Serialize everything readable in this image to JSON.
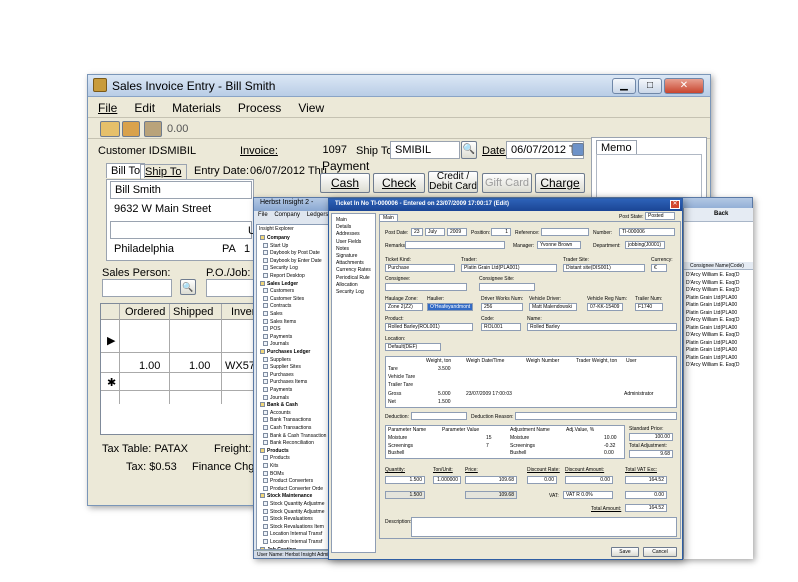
{
  "sales": {
    "title": "Sales Invoice Entry - Bill Smith",
    "menu": [
      {
        "label": "File"
      },
      {
        "label": "Edit"
      },
      {
        "label": "Materials"
      },
      {
        "label": "Process"
      },
      {
        "label": "View"
      }
    ],
    "toolbar_amount": "0.00",
    "customer_id_label": "Customer ID:",
    "customer_id": "SMIBIL",
    "invoice_label": "Invoice:",
    "invoice": "1097",
    "ship_to_label": "Ship To:",
    "ship_to": "SMIBIL",
    "date_label": "Date:",
    "date": "06/07/2012 Thu",
    "memo_tab": "Memo",
    "bill_to_tab": "Bill To",
    "ship_to_tab": "Ship To",
    "entry_date_label": "Entry Date:",
    "entry_date": "06/07/2012 Thu",
    "bill_name": "Bill Smith",
    "bill_street": "9632 W Main Street",
    "bill_city": "Philadelphia",
    "bill_state": "PA",
    "bill_zip": "1",
    "bill_extra": "U",
    "payment_label": "Payment",
    "payment_buttons": {
      "cash": "Cash",
      "check": "Check",
      "credit": "Credit / Debit Card",
      "gift": "Gift Card",
      "charge": "Charge"
    },
    "sales_person_label": "Sales Person:",
    "po_job_label": "P.O./Job:",
    "grid_headers": {
      "ordered": "Ordered",
      "shipped": "Shipped",
      "inv": "Inven"
    },
    "grid_row": {
      "ordered": "1.00",
      "shipped": "1.00",
      "inv": "WX57502"
    },
    "tax_table_label": "Tax Table: PATAX",
    "freight_label": "Freight:",
    "tax_label": "Tax: $0.53",
    "finance_label": "Finance Chg:"
  },
  "herbst": {
    "title": "Herbst Insight 2 - ",
    "menu": [
      "File",
      "Company",
      "Ledgers"
    ],
    "explorer_header": "Insight Explorer",
    "tree": [
      {
        "label": "Company",
        "group": true
      },
      {
        "label": "Start Up"
      },
      {
        "label": "Daybook by Post Date"
      },
      {
        "label": "Daybook by Enter Date"
      },
      {
        "label": "Security Log"
      },
      {
        "label": "Report Desktop"
      },
      {
        "label": "Sales Ledger",
        "group": true
      },
      {
        "label": "Customers"
      },
      {
        "label": "Customer Sites"
      },
      {
        "label": "Contracts"
      },
      {
        "label": "Sales"
      },
      {
        "label": "Sales Items"
      },
      {
        "label": "POS"
      },
      {
        "label": "Payments"
      },
      {
        "label": "Journals"
      },
      {
        "label": "Purchases Ledger",
        "group": true
      },
      {
        "label": "Suppliers"
      },
      {
        "label": "Supplier Sites"
      },
      {
        "label": "Purchases"
      },
      {
        "label": "Purchases Items"
      },
      {
        "label": "Payments"
      },
      {
        "label": "Journals"
      },
      {
        "label": "Bank & Cash",
        "group": true
      },
      {
        "label": "Accounts"
      },
      {
        "label": "Bank Transactions"
      },
      {
        "label": "Cash Transactions"
      },
      {
        "label": "Bank & Cash Transaction"
      },
      {
        "label": "Bank Reconciliation"
      },
      {
        "label": "Products",
        "group": true
      },
      {
        "label": "Products"
      },
      {
        "label": "Kits"
      },
      {
        "label": "BOMs"
      },
      {
        "label": "Product Converters"
      },
      {
        "label": "Product Converter Orde"
      },
      {
        "label": "Stock Maintenance",
        "group": true
      },
      {
        "label": "Stock Quantity Adjustme"
      },
      {
        "label": "Stock Quantity Adjustme"
      },
      {
        "label": "Stock Revaluations"
      },
      {
        "label": "Stock Revaluations Item"
      },
      {
        "label": "Location Internal Transf"
      },
      {
        "label": "Location Internal Transf"
      },
      {
        "label": "Job Costing",
        "group": true
      }
    ],
    "status": "User Name: Herbst Insight Admin",
    "right_nav": "Back",
    "right_header": "Consignee Name(Code)",
    "right_rows": [
      "D'Arcy William E. Esq(D",
      "D'Arcy William E. Esq(D",
      "D'Arcy William E. Esq(D",
      "Platin Grain Ltd(PLA00",
      "Platin Grain Ltd(PLA00",
      "Platin Grain Ltd(PLA00",
      "D'Arcy William E. Esq(D",
      "Platin Grain Ltd(PLA00",
      "D'Arcy William E. Esq(D",
      "Platin Grain Ltd(PLA00",
      "Platin Grain Ltd(PLA00",
      "Platin Grain Ltd(PLA00",
      "D'Arcy William E. Esq(D"
    ]
  },
  "ticket": {
    "title": "Ticket In No TI-000006 - Entered on 23/07/2009 17:00:17 (Edit)",
    "left_items": [
      "Main",
      "Details",
      "Addresses",
      "User Fields",
      "Notes",
      "Signature",
      "Attachments",
      "Currency Rates",
      "Periodical Rule",
      "Allocation",
      "Security Log"
    ],
    "tab_main": "Main",
    "post_state_label": "Post State:",
    "post_state": "Posted",
    "post_date_label": "Post Date:",
    "post_day": "23",
    "post_month": "July",
    "post_year": "2009",
    "position_label": "Position:",
    "position": "1",
    "reference_label": "Reference:",
    "number_label": "Number:",
    "number": "TI-000006",
    "remarks_label": "Remarks:",
    "manager_label": "Manager:",
    "manager": "Yvonne Brown",
    "department_label": "Department:",
    "department": "jobbing(J0001)",
    "ticket_kind_label": "Ticket Kind:",
    "ticket_kind": "Purchase",
    "trader_label": "Trader:",
    "trader": "Platin Grain Ltd(PLA001)",
    "trader_site_label": "Trader Site:",
    "trader_site": "Distant site(DIS001)",
    "currency_label": "Currency:",
    "currency": "€",
    "consignee_label": "Consignee:",
    "consignee_site_label": "Consignee Site:",
    "haulage_zone_label": "Haulage Zone:",
    "haulage_zone": "Zone 2(Z2)",
    "haulier_label": "Haulier:",
    "haulier": "O'Heafeyandmont",
    "driver_works_label": "Driver Works Num:",
    "driver_works": "256",
    "vehicle_driver_label": "Vehicle Driver:",
    "vehicle_driver": "Matt Malendowski",
    "vehicle_reg_label": "Vehicle Reg Num:",
    "vehicle_reg": "07-KK-15409",
    "trailer_label": "Trailer Num:",
    "trailer": "F1740",
    "product_label": "Product:",
    "product": "Rolled Barley(ROL001)",
    "code_label": "Code:",
    "code": "ROL001",
    "name_label": "Name:",
    "name": "Rolled Barley",
    "location_label": "Location:",
    "location": "Default(DEF)",
    "weigh_headers": [
      "Weight, ton",
      "Weigh Date/Time",
      "Weigh Number",
      "Trader Weight, ton",
      "User"
    ],
    "weigh_rows": [
      {
        "label": "Tare",
        "weight": "3.500",
        "dt": "",
        "user": ""
      },
      {
        "label": "Vehicle Tare",
        "weight": "",
        "dt": "",
        "user": ""
      },
      {
        "label": "Trailer Tare",
        "weight": "",
        "dt": "",
        "user": ""
      },
      {
        "label": "Gross",
        "weight": "5.000",
        "dt": "23/07/2009 17:00:03",
        "user": "Administrator"
      },
      {
        "label": "Net",
        "weight": "1.500",
        "dt": "",
        "user": ""
      }
    ],
    "deduction_label": "Deduction:",
    "deduction_reason_label": "Deduction Reason:",
    "param_headers": [
      "Parameter Name",
      "Parameter Value",
      "Adjustment Name",
      "Adj.Value, %"
    ],
    "params": [
      {
        "name": "Moisture",
        "value": "15",
        "adj": "Moisture",
        "adjval": "10.00"
      },
      {
        "name": "Screenings",
        "value": "7",
        "adj": "Screenings",
        "adjval": "-0.32"
      },
      {
        "name": "Bushell",
        "value": "",
        "adj": "Bushell",
        "adjval": "0.00"
      }
    ],
    "standard_price_label": "Standard Price:",
    "standard_price": "100.00",
    "total_adjustment_label": "Total Adjustment:",
    "total_adjustment": "9.68",
    "totals_headers": [
      "Quantity:",
      "Ton/Unit:",
      "Price:",
      "Discount Rate:",
      "Discount Amount:",
      "Total VAT Exc:"
    ],
    "quantity": "1.500",
    "ton_unit": "1.000000",
    "price": "109.68",
    "discount_rate": "0.00",
    "discount_amount": "0.00",
    "total_vat_exc": "164.52",
    "quantity2": "1.500",
    "price2": "109.68",
    "vat_label": "VAT:",
    "vat": "VAT R 0.0%",
    "vat_amount": "0.00",
    "total_amount_label": "Total Amount:",
    "total_amount": "164.52",
    "description_label": "Description:",
    "save_label": "Save",
    "cancel_label": "Cancel"
  }
}
